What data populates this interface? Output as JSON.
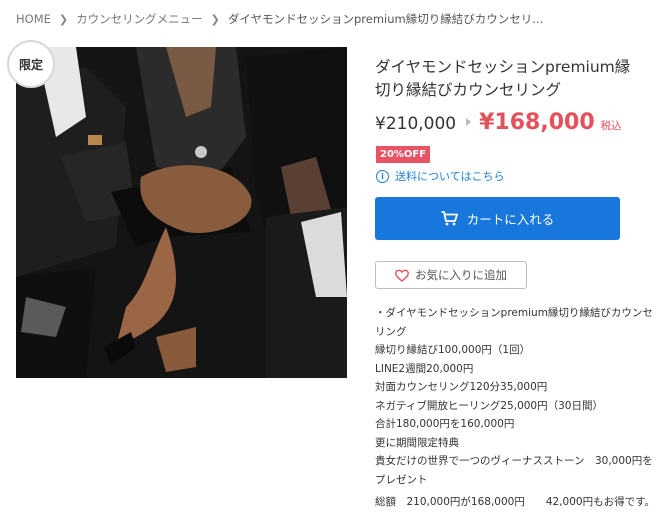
{
  "breadcrumb": {
    "home": "HOME",
    "category": "カウンセリングメニュー",
    "current": "ダイヤモンドセッションpremium縁切り縁結びカウンセリ..."
  },
  "product": {
    "badge": "限定",
    "title": "ダイヤモンドセッションpremium縁切り縁結びカウンセリング",
    "price_original": "¥210,000",
    "price_sale": "¥168,000",
    "tax_label": "税込",
    "discount_badge": "20%OFF",
    "shipping_link": "送料についてはこちら",
    "cart_button": "カートに入れる",
    "wishlist_button": "お気に入りに追加"
  },
  "description": {
    "lines": [
      "・ダイヤモンドセッションpremium縁切り縁結びカウンセリング",
      "縁切り縁結び100,000円（1回）",
      "LINE2週間20,000円",
      "対面カウンセリング120分35,000円",
      "ネガティブ開放ヒーリング25,000円（30日間）",
      "合計180,000円を160,000円",
      "更に期間限定特典",
      "貴女だけの世界で一つのヴィーナスストーン　30,000円をプレゼント"
    ],
    "total": "総額　210,000円が168,000円　　42,000円もお得です。"
  },
  "colors": {
    "sale_red": "#e6505a",
    "primary_blue": "#1777dc",
    "link_blue": "#1f7fd6"
  },
  "icons": [
    "chevron-right-icon",
    "info-icon",
    "cart-icon",
    "heart-icon"
  ]
}
